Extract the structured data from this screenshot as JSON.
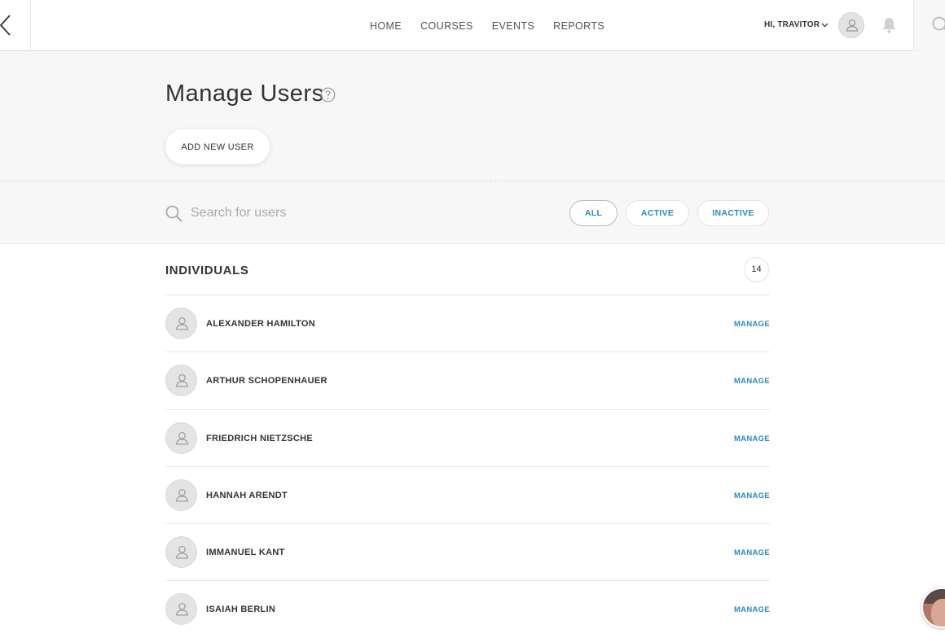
{
  "nav": {
    "items": [
      "HOME",
      "COURSES",
      "EVENTS",
      "REPORTS"
    ],
    "greeting": "HI, TRAVITOR"
  },
  "page": {
    "title": "Manage Users",
    "add_button": "ADD NEW USER"
  },
  "filter": {
    "search_placeholder": "Search for users",
    "pills": [
      "ALL",
      "ACTIVE",
      "INACTIVE"
    ],
    "selected": "ALL"
  },
  "list": {
    "title": "INDIVIDUALS",
    "count": "14",
    "manage_label": "MANAGE",
    "users": [
      "ALEXANDER HAMILTON",
      "ARTHUR SCHOPENHAUER",
      "FRIEDRICH NIETZSCHE",
      "HANNAH ARENDT",
      "IMMANUEL KANT",
      "ISAIAH BERLIN"
    ]
  },
  "colors": {
    "accent": "#2a8bbf",
    "background": "#f7f7f7"
  },
  "icons": [
    "back-arrow-icon",
    "chevron-down-icon",
    "user-icon",
    "bell-icon",
    "search-icon",
    "help-icon"
  ]
}
